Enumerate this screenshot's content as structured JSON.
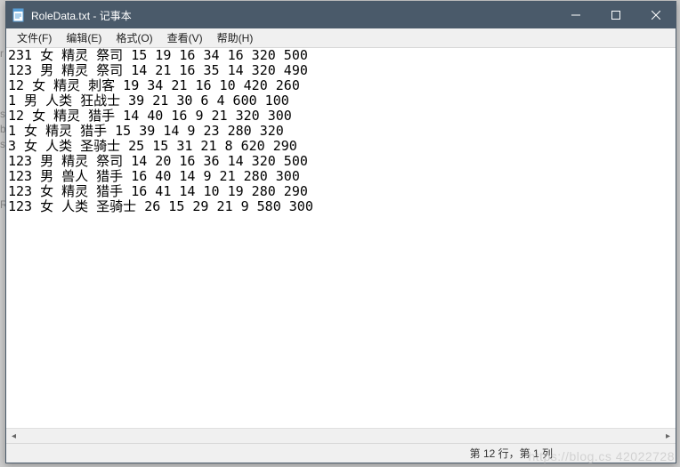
{
  "window": {
    "title": "RoleData.txt - 记事本"
  },
  "menubar": {
    "file": "文件(F)",
    "edit": "编辑(E)",
    "format": "格式(O)",
    "view": "查看(V)",
    "help": "帮助(H)"
  },
  "content_lines": [
    "231 女 精灵 祭司 15 19 16 34 16 320 500",
    "123 男 精灵 祭司 14 21 16 35 14 320 490",
    "12 女 精灵 刺客 19 34 21 16 10 420 260",
    "1 男 人类 狂战士 39 21 30 6 4 600 100",
    "12 女 精灵 猎手 14 40 16 9 21 320 300",
    "1 女 精灵 猎手 15 39 14 9 23 280 320",
    "3 女 人类 圣骑士 25 15 31 21 8 620 290",
    "123 男 精灵 祭司 14 20 16 36 14 320 500",
    "123 男 兽人 猎手 16 40 14 9 21 280 300",
    "123 女 精灵 猎手 16 41 14 10 19 280 290",
    "123 女 人类 圣骑士 26 15 29 21 9 580 300"
  ],
  "statusbar": {
    "position": "第 12 行，第 1 列"
  },
  "watermark": "https://blog.cs    42022728",
  "left_artifact": "r\n\n\n\ns\nb\ns\n\n\n\nR"
}
